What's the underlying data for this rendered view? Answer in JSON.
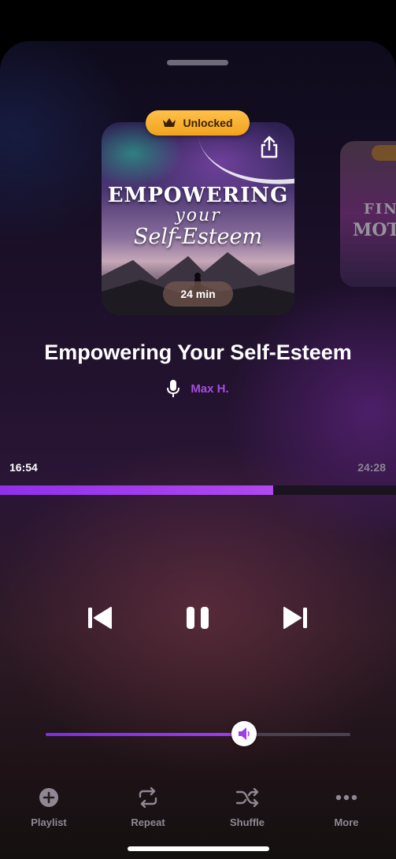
{
  "badge": {
    "label": "Unlocked",
    "icon": "crown-icon"
  },
  "cover": {
    "line1": "EMPOWERING",
    "line2": "your",
    "line3": "Self-Esteem",
    "duration": "24 min"
  },
  "next_cover": {
    "line1": "FIN",
    "line2": "MOTI"
  },
  "track": {
    "title": "Empowering Your Self-Esteem",
    "author": "Max H."
  },
  "playback": {
    "current_time": "16:54",
    "total_time": "24:28",
    "progress": 0.69,
    "volume": 0.65
  },
  "nav": {
    "playlist": "Playlist",
    "repeat": "Repeat",
    "shuffle": "Shuffle",
    "more": "More"
  },
  "colors": {
    "accent": "#a44ee0",
    "badge": "#f7b12f"
  }
}
